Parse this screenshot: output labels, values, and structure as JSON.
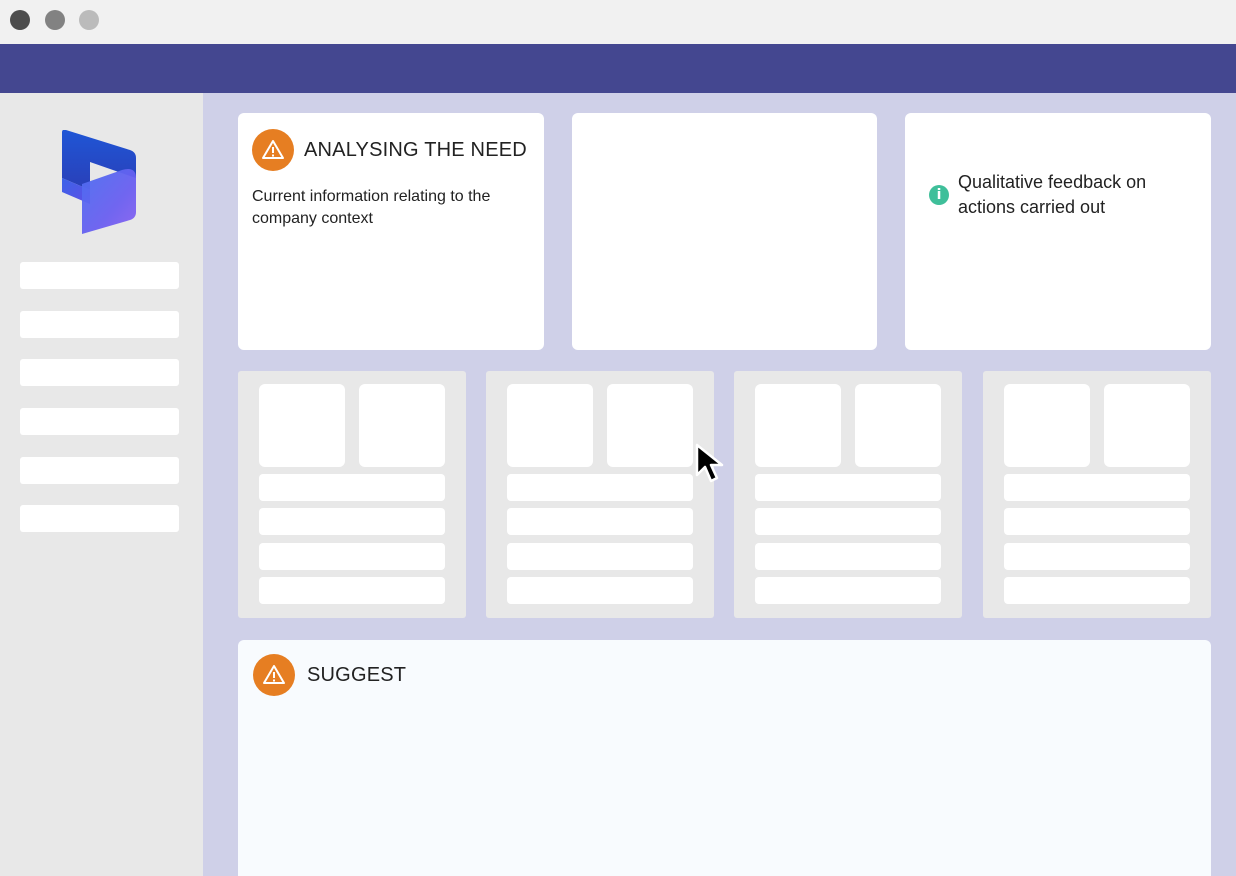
{
  "window": {
    "controls": [
      "close",
      "minimize",
      "maximize"
    ],
    "dot_colors": [
      "#4d4d4d",
      "#828282",
      "#bbbbbb"
    ]
  },
  "colors": {
    "appbar": "#444790",
    "workspace": "#cfd0e8",
    "warning": "#e67e22",
    "info": "#3fbf9a",
    "suggest_bg": "#f8fbfe"
  },
  "cards": {
    "analysis": {
      "title": "ANALYSING THE NEED",
      "body": "Current information relating to the company context",
      "icon": "warning-icon"
    },
    "feedback": {
      "text": "Qualitative feedback on actions carried out",
      "icon": "info-icon",
      "icon_glyph": "i"
    },
    "suggest": {
      "title": "SUGGEST",
      "icon": "warning-icon"
    }
  },
  "sidebar": {
    "logo": "dynamics-logo",
    "item_count": 6
  },
  "panels": {
    "count": 4,
    "tiles_per_panel": 2,
    "rows_per_panel": 4
  },
  "cursor": "mouse-pointer-icon"
}
